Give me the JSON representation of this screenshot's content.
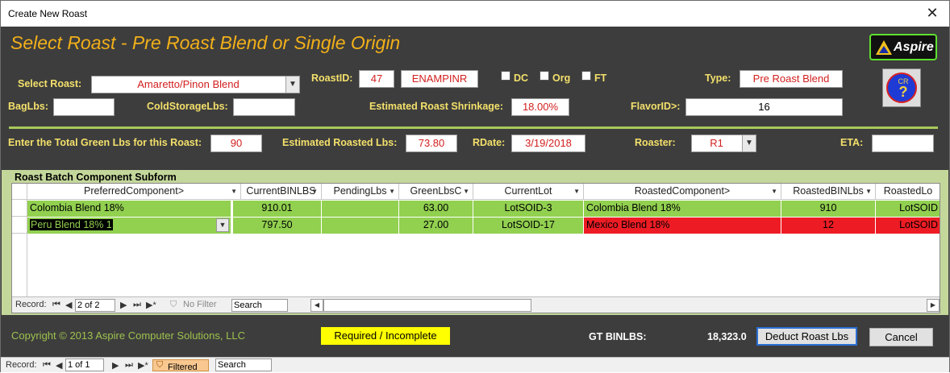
{
  "window": {
    "title": "Create New Roast",
    "close_glyph": "✕"
  },
  "header": {
    "heading": "Select Roast - Pre Roast Blend or Single Origin",
    "logo_text": "Aspire",
    "help_icon_text": "CR",
    "help_icon_glyph": "?"
  },
  "fields": {
    "select_roast_label": "Select Roast:",
    "select_roast_value": "Amaretto/Pinon Blend",
    "roast_id_label": "RoastID:",
    "roast_id_value": "47",
    "roast_code_value": "ENAMPINR",
    "dc_label": "DC",
    "org_label": "Org",
    "ft_label": "FT",
    "type_label": "Type:",
    "type_value": "Pre Roast Blend",
    "baglbs_label": "BagLbs:",
    "baglbs_value": "",
    "cold_storage_label": "ColdStorageLbs:",
    "cold_storage_value": "",
    "shrinkage_label": "Estimated Roast Shrinkage:",
    "shrinkage_value": "18.00%",
    "flavor_id_label": "FlavorID>:",
    "flavor_id_value": "16",
    "green_lbs_label": "Enter the Total Green Lbs for this Roast:",
    "green_lbs_value": "90",
    "roasted_lbs_label": "Estimated Roasted Lbs:",
    "roasted_lbs_value": "73.80",
    "rdate_label": "RDate:",
    "rdate_value": "3/19/2018",
    "roaster_label": "Roaster:",
    "roaster_value": "R1",
    "eta_label": "ETA:",
    "eta_value": ""
  },
  "subform": {
    "caption": "Roast Batch Component Subform",
    "columns": [
      "PreferredComponent>",
      "CurrentBINLBS",
      "PendingLbs",
      "GreenLbsC",
      "CurrentLot",
      "RoastedComponent>",
      "RoastedBINLbs",
      "RoastedLo"
    ],
    "rows": [
      {
        "preferred": "Colombia Blend 18%",
        "current_bin": "910.01",
        "pending": "",
        "green": "63.00",
        "lot": "LotSOID-3",
        "roasted_comp": "Colombia Blend 18%",
        "roasted_bin": "910",
        "roasted_lot": "LotSOID"
      },
      {
        "preferred": "Peru Blend 18% 1",
        "current_bin": "797.50",
        "pending": "",
        "green": "27.00",
        "lot": "LotSOID-17",
        "roasted_comp": "Mexico Blend 18%",
        "roasted_bin": "12",
        "roasted_lot": "LotSOID"
      }
    ],
    "nav": {
      "record_label": "Record:",
      "position": "2 of 2",
      "filter_label": "No Filter",
      "search_label": "Search"
    }
  },
  "footer": {
    "copyright": "Copyright © 2013  Aspire Computer Solutions, LLC",
    "status": "Required / Incomplete",
    "gt_label": "GT BINLBS:",
    "gt_value": "18,323.0",
    "deduct_button": "Deduct Roast Lbs",
    "cancel_button": "Cancel"
  },
  "main_nav": {
    "record_label": "Record:",
    "position": "1 of 1",
    "filter_label": "Filtered",
    "search_label": "Search"
  },
  "colors": {
    "form_bg": "#3d3d3d",
    "heading": "#f2b019",
    "label": "#f3e06b",
    "value_red": "#d2201f",
    "row_green": "#92d050",
    "row_red": "#ed1c24",
    "subform_bg": "#c4d79b"
  }
}
